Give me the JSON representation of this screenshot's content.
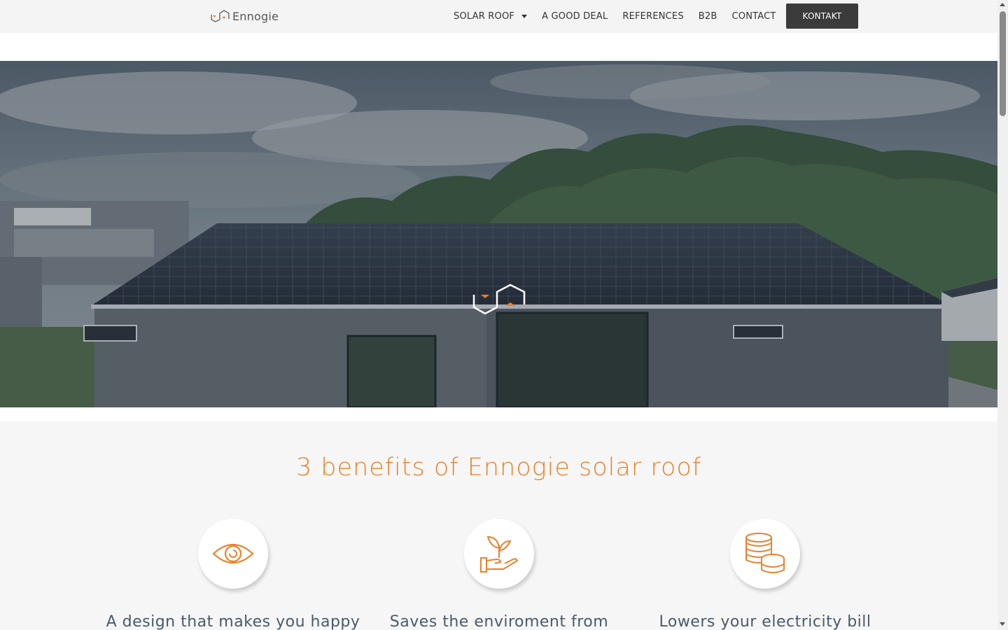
{
  "header": {
    "logo_text": "Ennogie",
    "nav": [
      {
        "label": "SOLAR ROOF",
        "has_dropdown": true
      },
      {
        "label": "A GOOD DEAL"
      },
      {
        "label": "REFERENCES"
      },
      {
        "label": "B2B"
      },
      {
        "label": "CONTACT"
      }
    ],
    "cta_label": "KONTAKT"
  },
  "hero": {
    "image": "house-with-solar-roof",
    "overlay_icon": "ennogie-logo-mark"
  },
  "benefits": {
    "title": "3 benefits of Ennogie solar roof",
    "items": [
      {
        "icon": "eye-icon",
        "text": "A design that makes you happy"
      },
      {
        "icon": "plant-in-hand-icon",
        "text": "Saves the enviroment from"
      },
      {
        "icon": "coins-icon",
        "text": "Lowers your electricity bill"
      }
    ]
  },
  "colors": {
    "accent": "#e8822c",
    "header_bg": "#f4f4f4",
    "button_bg": "#3b3b3b",
    "section_bg": "#f6f6f6",
    "text_dark": "#4a5a6a"
  }
}
